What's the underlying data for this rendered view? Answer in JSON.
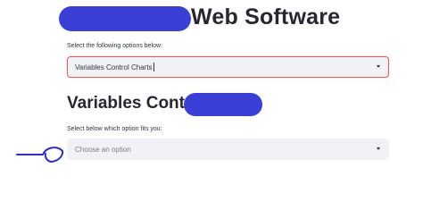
{
  "header": {
    "title": "Web Software"
  },
  "select_one": {
    "label": "Select the following options below:",
    "value": "Variables Control Charts"
  },
  "section": {
    "heading": "Variables Contro"
  },
  "select_two": {
    "label": "Select below which option fits you:",
    "placeholder": "Choose an option"
  },
  "colors": {
    "redaction": "#3b3fd6",
    "focus_border": "#ff4b4b",
    "input_bg": "#f0f2f6"
  }
}
